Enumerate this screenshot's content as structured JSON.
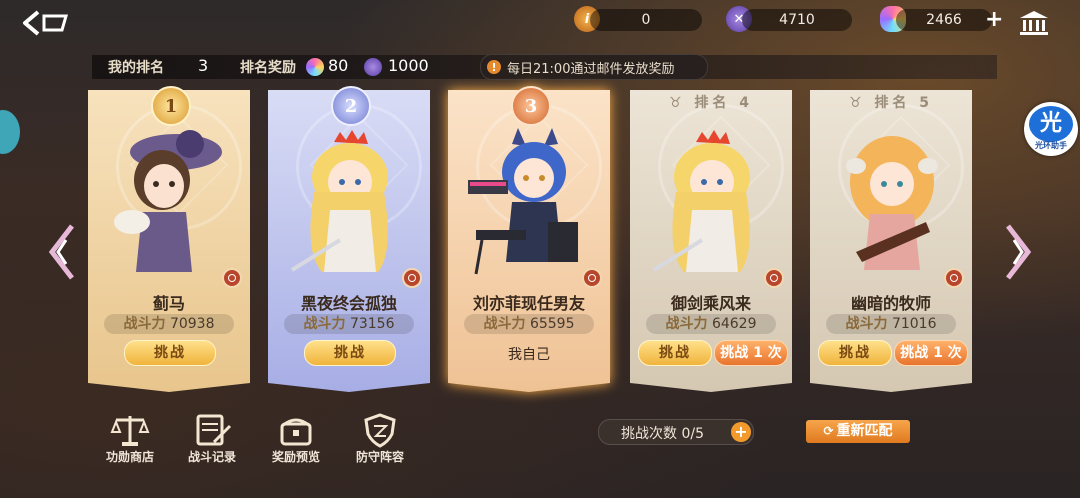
{
  "topbar": {
    "currency1": "0",
    "currency2": "4710",
    "currency3": "2466",
    "plus": "+"
  },
  "rankbar": {
    "my_rank_label": "我的排名",
    "my_rank_value": "3",
    "reward_label": "排名奖励",
    "reward_gems": "80",
    "reward_coins": "1000",
    "notice": "每日21:00通过邮件发放奖励"
  },
  "side_button": {
    "icon_char": "光",
    "label": "光环助手"
  },
  "cards": [
    {
      "rank_num": "1",
      "name": "蓟马",
      "power_label": "战斗力",
      "power": "70938",
      "btn1": "挑战",
      "colors": {
        "bg1": "#f7e2bd",
        "bg2": "#e8c58c",
        "medal": "#e3b04a"
      }
    },
    {
      "rank_num": "2",
      "name": "黑夜终会孤独",
      "power_label": "战斗力",
      "power": "73156",
      "btn1": "挑战",
      "colors": {
        "bg1": "#d9dcf5",
        "bg2": "#a7aee5",
        "medal": "#8a96dc"
      }
    },
    {
      "rank_num": "3",
      "name": "刘亦菲现任男友",
      "power_label": "战斗力",
      "power": "65595",
      "self_label": "我自己",
      "colors": {
        "bg1": "#fbe3c8",
        "bg2": "#efc294",
        "medal": "#e2844a"
      }
    },
    {
      "rank_head": "排名",
      "rank_num": "4",
      "name": "御剑乘风来",
      "power_label": "战斗力",
      "power": "64629",
      "btn1": "挑战",
      "btn2": "挑战 1 次",
      "colors": {
        "bg1": "#ece4d6",
        "bg2": "#d5c8b2"
      }
    },
    {
      "rank_head": "排名",
      "rank_num": "5",
      "name": "幽暗的牧师",
      "power_label": "战斗力",
      "power": "71016",
      "btn1": "挑战",
      "btn2": "挑战 1 次",
      "colors": {
        "bg1": "#ece4d6",
        "bg2": "#d5c8b2"
      }
    }
  ],
  "bottom": {
    "shop": "功勋商店",
    "record": "战斗记录",
    "preview": "奖励预览",
    "defense": "防守阵容",
    "chances_label": "挑战次数 0/5",
    "rematch": "重新匹配"
  }
}
